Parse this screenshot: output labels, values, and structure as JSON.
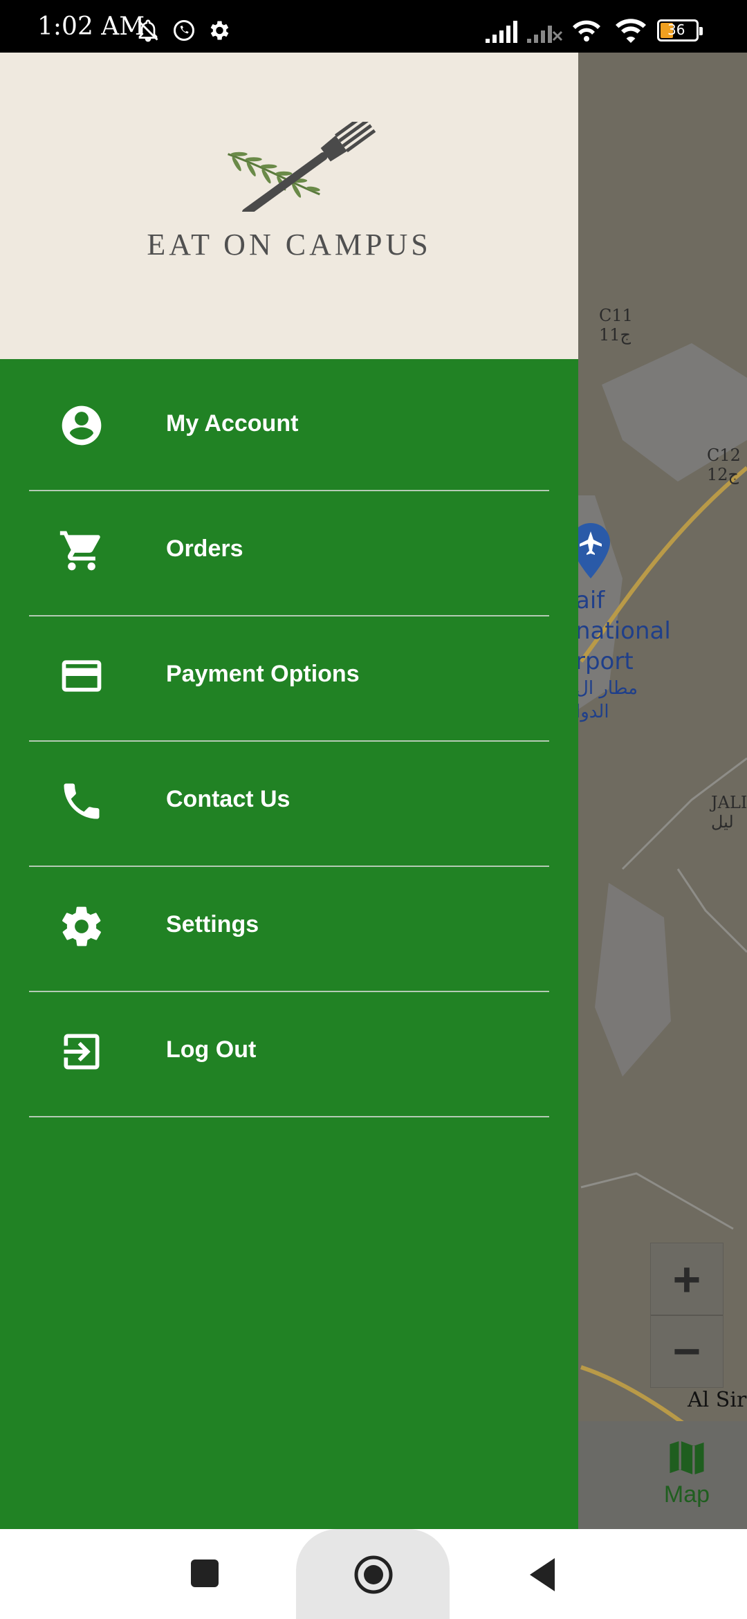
{
  "status_bar": {
    "time": "1:02 AM",
    "battery": "36"
  },
  "map": {
    "labels": {
      "c11": "C11",
      "c11_ar": "ج11",
      "c12": "C12",
      "c12_ar": "ج12",
      "jali": "JALI",
      "jali_ar": "ليل",
      "al_sir": "Al Sir",
      "airport_1": "aif",
      "airport_2": "national",
      "airport_3": "rport",
      "airport_ar_1": "مطار ال",
      "airport_ar_2": "الدوا"
    },
    "zoom_in": "+",
    "zoom_out": "−",
    "bottom_tab_label": "Map"
  },
  "drawer": {
    "logo_text": "EAT ON CAMPUS",
    "menu": [
      {
        "label": "My Account",
        "icon": "account-circle-icon"
      },
      {
        "label": "Orders",
        "icon": "cart-icon"
      },
      {
        "label": "Payment Options",
        "icon": "credit-card-icon"
      },
      {
        "label": "Contact Us",
        "icon": "phone-icon"
      },
      {
        "label": "Settings",
        "icon": "gear-icon"
      },
      {
        "label": "Log Out",
        "icon": "logout-icon"
      }
    ]
  },
  "colors": {
    "drawer_green": "#218224",
    "header_bg": "#efe9df",
    "map_dim": "#6f6b60"
  }
}
